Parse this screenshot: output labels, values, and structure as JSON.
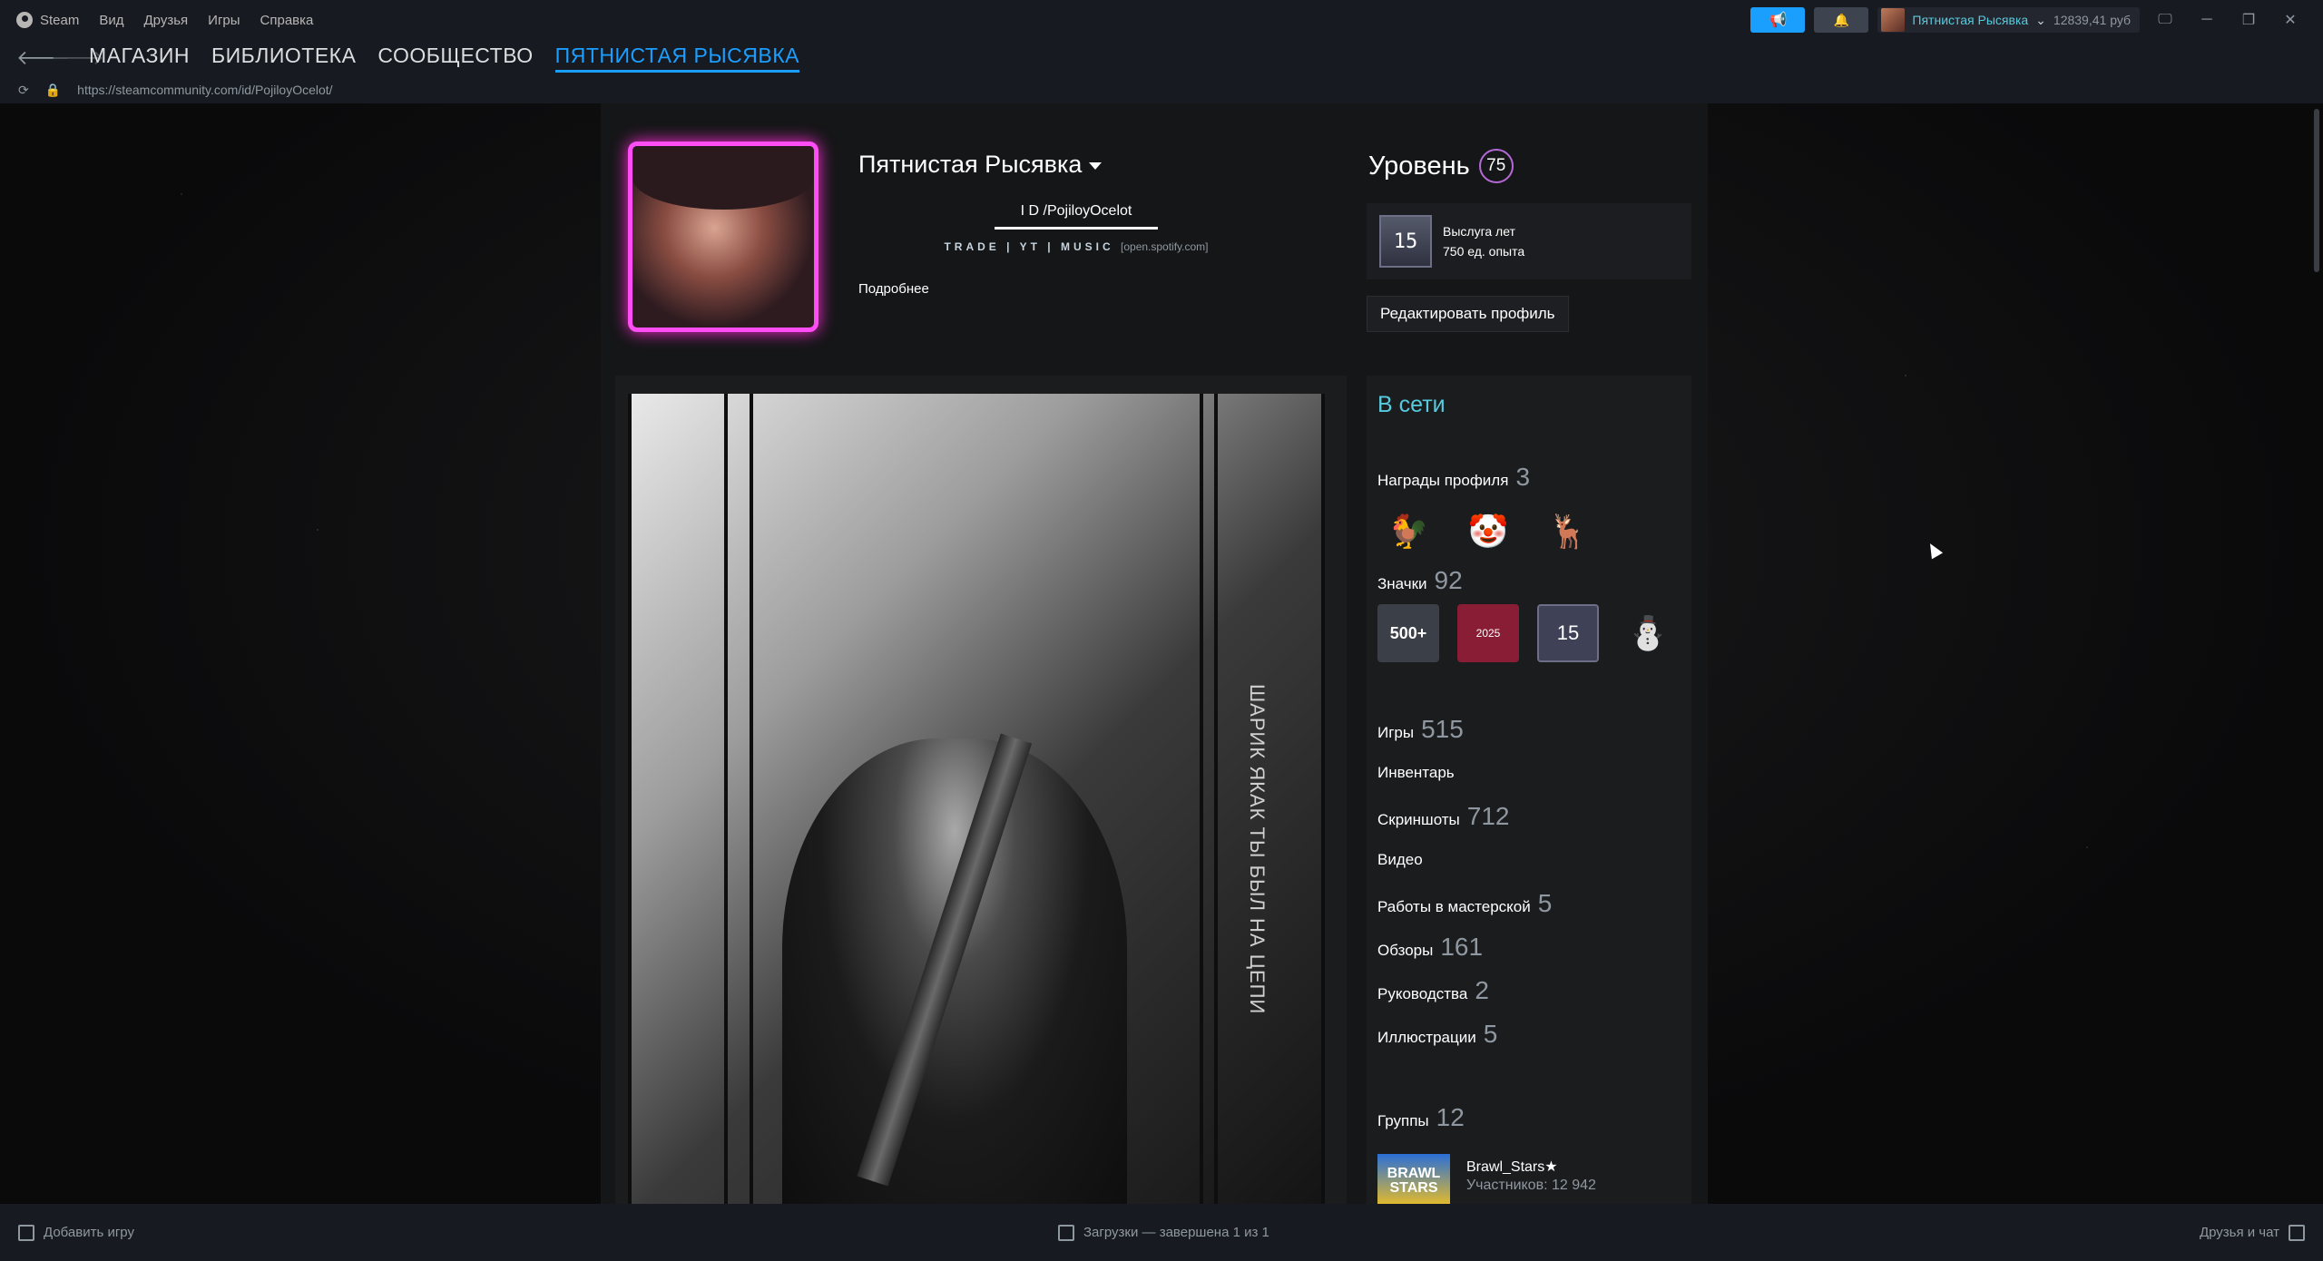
{
  "menubar": {
    "app": "Steam",
    "items": [
      "Вид",
      "Друзья",
      "Игры",
      "Справка"
    ],
    "account_name": "Пятнистая Рысявка",
    "balance": "12839,41 руб"
  },
  "nav": {
    "tabs": [
      "МАГАЗИН",
      "БИБЛИОТЕКА",
      "СООБЩЕСТВО",
      "ПЯТНИСТАЯ РЫСЯВКА"
    ],
    "url": "https://steamcommunity.com/id/PojiloyOcelot/"
  },
  "profile": {
    "name": "Пятнистая Рысявка",
    "summary_id": "I D /PojiloyOcelot",
    "summary_links": [
      "TRADE",
      "YT",
      "MUSIC"
    ],
    "summary_spotify": "[open.spotify.com]",
    "more": "Подробнее",
    "level_label": "Уровень",
    "level": "75",
    "years_badge": "15",
    "years_title": "Выслуга лет",
    "years_xp": "750 ед. опыта",
    "edit_button": "Редактировать профиль",
    "showcase_text": "ШАРИК ЯКАК ТЫ БЫЛ НА ЦЕПИ"
  },
  "sidebar": {
    "status": "В сети",
    "awards_label": "Награды профиля",
    "awards_count": "3",
    "badges_label": "Значки",
    "badges_count": "92",
    "badge_icons": [
      "500+",
      "2025",
      "15"
    ],
    "stats": [
      {
        "label": "Игры",
        "count": "515"
      },
      {
        "label": "Инвентарь",
        "count": ""
      },
      {
        "label": "Скриншоты",
        "count": "712"
      },
      {
        "label": "Видео",
        "count": ""
      },
      {
        "label": "Работы в мастерской",
        "count": "5"
      },
      {
        "label": "Обзоры",
        "count": "161"
      },
      {
        "label": "Руководства",
        "count": "2"
      },
      {
        "label": "Иллюстрации",
        "count": "5"
      }
    ],
    "groups_label": "Группы",
    "groups_count": "12",
    "group_name": "Brawl_Stars★",
    "group_members": "Участников: 12 942",
    "group_logo": "BRAWL STARS"
  },
  "footer": {
    "add_game": "Добавить игру",
    "downloads": "Загрузки — завершена 1 из 1",
    "friends": "Друзья и чат"
  }
}
